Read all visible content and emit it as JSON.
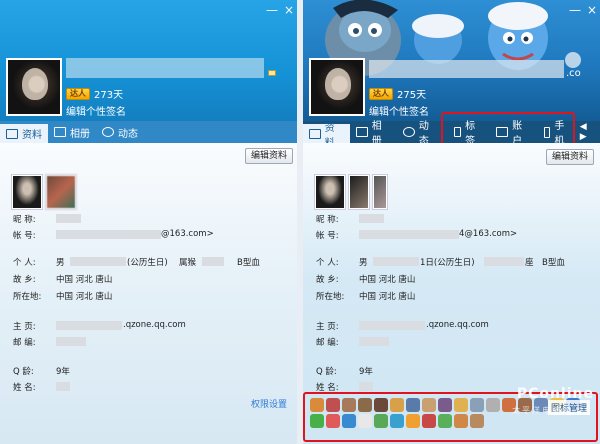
{
  "left": {
    "header": {
      "close_glyph": "×",
      "minimize_glyph": "—",
      "badge_text": "达人",
      "days": "273天",
      "signature": "编辑个性签名"
    },
    "tabs": [
      {
        "label": "资料",
        "icon": "profile-card-icon",
        "active": true
      },
      {
        "label": "相册",
        "icon": "photo-album-icon",
        "active": false
      },
      {
        "label": "动态",
        "icon": "activity-icon",
        "active": false
      }
    ],
    "edit_button": "编辑资料",
    "fields": {
      "nickname_label": "昵    称:",
      "account_label": "帐    号:",
      "account_value": "@163.com>",
      "personal_label": "个    人:",
      "personal_gender": "男",
      "personal_birthday": "(公历生日)",
      "personal_zodiac": "属猴",
      "personal_blood": "B型血",
      "hometown_label": "故    乡:",
      "hometown_value": "中国  河北  唐山",
      "location_label": "所在地:",
      "location_value": "中国  河北  唐山",
      "homepage_label": "主    页:",
      "homepage_value": ".qzone.qq.com",
      "email_label": "邮    编:",
      "qage_label": "Q    龄:",
      "qage_value": "9年",
      "name_label": "姓    名:"
    },
    "permission_link": "权限设置"
  },
  "right": {
    "header": {
      "close_glyph": "×",
      "minimize_glyph": "—",
      "badge_text": "达人",
      "days": "275天",
      "signature": "编辑个性签名",
      "domain_fragment": ".co"
    },
    "tabs": [
      {
        "label": "资料",
        "icon": "profile-card-icon",
        "active": true
      },
      {
        "label": "相册",
        "icon": "photo-album-icon",
        "active": false
      },
      {
        "label": "动态",
        "icon": "activity-icon",
        "active": false
      },
      {
        "label": "标签",
        "icon": "bookmark-icon",
        "active": false
      },
      {
        "label": "账户",
        "icon": "briefcase-icon",
        "active": false
      },
      {
        "label": "手机",
        "icon": "phone-icon",
        "active": false
      }
    ],
    "nav_arrows": "◀ ▶",
    "edit_button": "编辑资料",
    "fields": {
      "nickname_label": "昵    称:",
      "account_label": "帐    号:",
      "account_value": "4@163.com>",
      "personal_label": "个    人:",
      "personal_gender": "男",
      "personal_birthday": "1日(公历生日)",
      "personal_zodiac": "座",
      "personal_blood": "B型血",
      "hometown_label": "故    乡:",
      "hometown_value": "中国  河北  唐山",
      "location_label": "所在地:",
      "location_value": "中国  河北  唐山",
      "homepage_label": "主    页:",
      "homepage_value": ".qzone.qq.com",
      "email_label": "邮    编:",
      "qage_label": "Q    龄:",
      "qage_value": "9年",
      "name_label": "姓    名:"
    },
    "tray": {
      "magic_label": "图标管理"
    },
    "watermark": "PConline",
    "watermark_sub": "太平洋电脑网"
  },
  "colors": {
    "highlight_box": "#e0141e",
    "link": "#2e7bd3"
  }
}
